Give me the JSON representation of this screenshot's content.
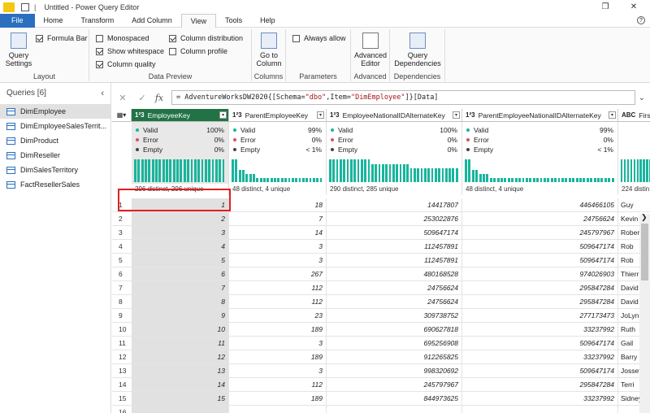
{
  "window": {
    "title": "Untitled - Power Query Editor",
    "separator": "|"
  },
  "menu": {
    "items": [
      "File",
      "Home",
      "Transform",
      "Add Column",
      "View",
      "Tools",
      "Help"
    ],
    "active": "View"
  },
  "ribbon": {
    "layout": {
      "label": "Layout",
      "query_settings": "Query Settings",
      "formula_bar": "Formula Bar",
      "formula_bar_on": true
    },
    "data_preview": {
      "label": "Data Preview",
      "monospaced": "Monospaced",
      "show_whitespace": "Show whitespace",
      "column_quality": "Column quality",
      "column_distribution": "Column distribution",
      "column_profile": "Column profile"
    },
    "columns": {
      "label": "Columns",
      "goto": "Go to Column"
    },
    "parameters": {
      "label": "Parameters",
      "always_allow": "Always allow"
    },
    "advanced": {
      "label": "Advanced",
      "editor": "Advanced Editor"
    },
    "dependencies": {
      "label": "Dependencies",
      "query_deps": "Query Dependencies"
    }
  },
  "queries": {
    "header": "Queries [6]",
    "items": [
      "DimEmployee",
      "DimEmployeeSalesTerrit...",
      "DimProduct",
      "DimReseller",
      "DimSalesTerritory",
      "FactResellerSales"
    ],
    "selected": 0
  },
  "formula": {
    "prefix": "= AdventureWorksDW2020{[Schema=",
    "schema": "\"dbo\"",
    "mid": ",Item=",
    "item": "\"DimEmployee\"",
    "suffix": "]}[Data]"
  },
  "columns": [
    {
      "name": "EmployeeKey",
      "type": "1²3",
      "valid": "100%",
      "error": "0%",
      "empty": "0%",
      "distinct": "296 distinct, 296 unique"
    },
    {
      "name": "ParentEmployeeKey",
      "type": "1²3",
      "valid": "99%",
      "error": "0%",
      "empty": "< 1%",
      "distinct": "48 distinct, 4 unique"
    },
    {
      "name": "EmployeeNationalIDAlternateKey",
      "type": "1²3",
      "valid": "100%",
      "error": "0%",
      "empty": "0%",
      "distinct": "290 distinct, 285 unique"
    },
    {
      "name": "ParentEmployeeNationalIDAlternateKey",
      "type": "1²3",
      "valid": "99%",
      "error": "0%",
      "empty": "< 1%",
      "distinct": "48 distinct, 4 unique"
    },
    {
      "name": "FirstN",
      "type": "ABC",
      "valid": "",
      "error": "",
      "empty": "",
      "distinct": "224 distin"
    }
  ],
  "quality_labels": {
    "valid": "Valid",
    "error": "Error",
    "empty": "Empty"
  },
  "quality_colors": {
    "valid": "#18b59c",
    "error": "#e05050",
    "empty": "#444444"
  },
  "rows": [
    [
      "1",
      "1",
      "18",
      "14417807",
      "446466105",
      "Guy"
    ],
    [
      "2",
      "2",
      "7",
      "253022876",
      "24756624",
      "Kevin"
    ],
    [
      "3",
      "3",
      "14",
      "509647174",
      "245797967",
      "Rober"
    ],
    [
      "4",
      "4",
      "3",
      "112457891",
      "509647174",
      "Rob"
    ],
    [
      "5",
      "5",
      "3",
      "112457891",
      "509647174",
      "Rob"
    ],
    [
      "6",
      "6",
      "267",
      "480168528",
      "974026903",
      "Thierr"
    ],
    [
      "7",
      "7",
      "112",
      "24756624",
      "295847284",
      "David"
    ],
    [
      "8",
      "8",
      "112",
      "24756624",
      "295847284",
      "David"
    ],
    [
      "9",
      "9",
      "23",
      "309738752",
      "277173473",
      "JoLynr"
    ],
    [
      "10",
      "10",
      "189",
      "690627818",
      "33237992",
      "Ruth"
    ],
    [
      "11",
      "11",
      "3",
      "695256908",
      "509647174",
      "Gail"
    ],
    [
      "12",
      "12",
      "189",
      "912265825",
      "33237992",
      "Barry"
    ],
    [
      "13",
      "13",
      "3",
      "998320692",
      "509647174",
      "Jossef"
    ],
    [
      "14",
      "14",
      "112",
      "245797967",
      "295847284",
      "Terri"
    ],
    [
      "15",
      "15",
      "189",
      "844973625",
      "33237992",
      "Sidney"
    ],
    [
      "16",
      "",
      "",
      "",
      "",
      ""
    ]
  ]
}
